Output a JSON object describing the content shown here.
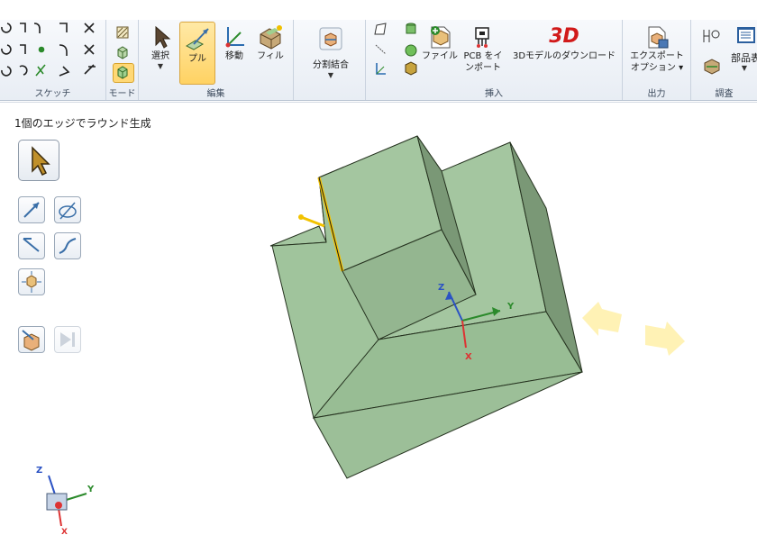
{
  "ribbon": {
    "groups": [
      {
        "id": "sketch",
        "label": "スケッチ"
      },
      {
        "id": "mode",
        "label": "モード"
      },
      {
        "id": "edit",
        "label": "編集"
      },
      {
        "id": "split",
        "label": ""
      },
      {
        "id": "insert",
        "label": "挿入"
      },
      {
        "id": "output",
        "label": "出力"
      },
      {
        "id": "inspect",
        "label": "調査"
      }
    ],
    "buttons": {
      "select": "選択",
      "pull": "プル",
      "move": "移動",
      "fill": "フィル",
      "combine": "分割結合",
      "file": "ファイル",
      "pcb_line1": "PCB をイ",
      "pcb_line2": "ンポート",
      "download": "3Dモデルのダウンロード",
      "export_line1": "エクスポート",
      "export_line2": "オプション",
      "parts": "部品表"
    },
    "logo_3d": "3D"
  },
  "canvas": {
    "status": "1個のエッジでラウンド生成",
    "axis_labels": {
      "z": "Z",
      "y": "Y",
      "x": "X"
    }
  },
  "colors": {
    "solid_face_top": "#a4c6a0",
    "solid_face_side": "#94b690",
    "edge_highlight": "#f2c200",
    "accent": "#f7d468"
  }
}
